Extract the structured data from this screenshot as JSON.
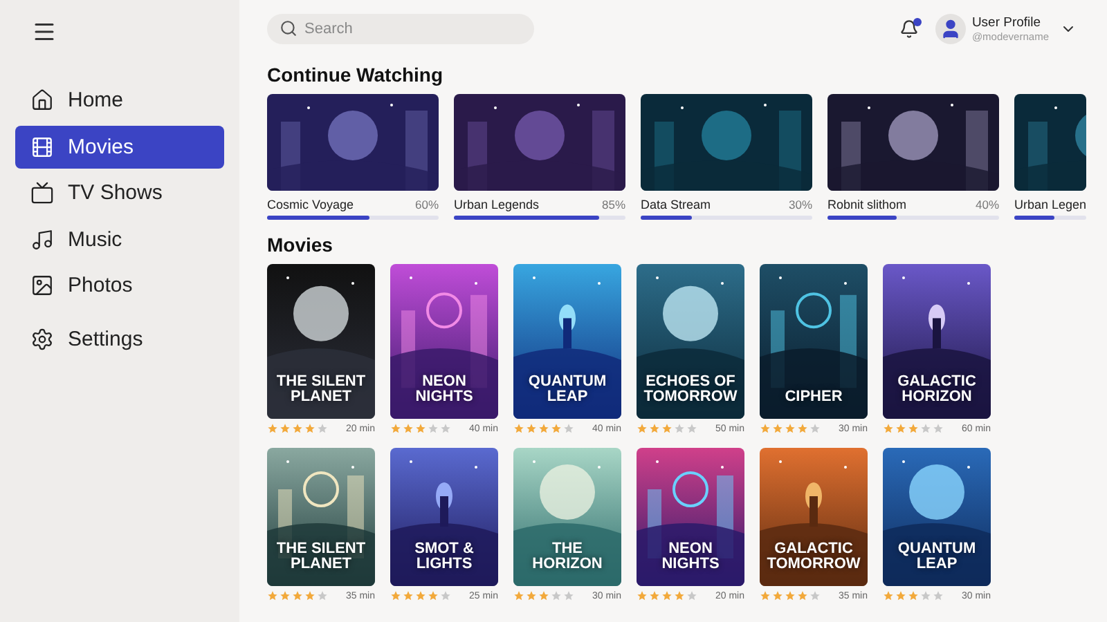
{
  "sidebar": {
    "items": [
      {
        "label": "Home",
        "selected": false
      },
      {
        "label": "Movies",
        "selected": true
      },
      {
        "label": "TV Shows",
        "selected": false
      },
      {
        "label": "Music",
        "selected": false
      },
      {
        "label": "Photos",
        "selected": false
      },
      {
        "label": "Settings",
        "selected": false
      }
    ]
  },
  "search": {
    "placeholder": "Search"
  },
  "notifications": {
    "unread": true
  },
  "profile": {
    "name": "User Profile",
    "handle": "@modevername"
  },
  "continue_watching": {
    "title": "Continue Watching",
    "items": [
      {
        "title": "Cosmic Voyage",
        "progress": "60%",
        "level": 0.6
      },
      {
        "title": "Urban Legends",
        "progress": "85%",
        "level": 0.85
      },
      {
        "title": "Data Stream",
        "progress": "30%",
        "level": 0.3
      },
      {
        "title": "Robnit slithom",
        "progress": "40%",
        "level": 0.4
      },
      {
        "title": "Urban Legen",
        "level": 0.55
      }
    ]
  },
  "movies": {
    "title": "Movies",
    "rows": [
      [
        {
          "title": "THE SILENT PLANET",
          "stars": 4,
          "duration": "20 min"
        },
        {
          "title": "NEON NIGHTS",
          "stars": 3,
          "duration": "40 min"
        },
        {
          "title": "QUANTUM LEAP",
          "stars": 4,
          "duration": "40 min"
        },
        {
          "title": "ECHOES OF TOMORROW",
          "stars": 3,
          "duration": "50 min"
        },
        {
          "title": "CIPHER",
          "stars": 4,
          "duration": "30 min"
        },
        {
          "title": "GALACTIC HORIZON",
          "stars": 3,
          "duration": "60 min"
        }
      ],
      [
        {
          "title": "THE SILENT PLANET",
          "stars": 4,
          "duration": "35 min"
        },
        {
          "title": "SMOT & LIGHTS",
          "stars": 4,
          "duration": "25 min"
        },
        {
          "title": "THE HORIZON",
          "stars": 3,
          "duration": "30 min"
        },
        {
          "title": "NEON NIGHTS",
          "stars": 4,
          "duration": "20 min"
        },
        {
          "title": "GALACTIC TOMORROW",
          "stars": 4,
          "duration": "35 min"
        },
        {
          "title": "QUANTUM LEAP",
          "stars": 3,
          "duration": "30 min"
        }
      ]
    ]
  }
}
